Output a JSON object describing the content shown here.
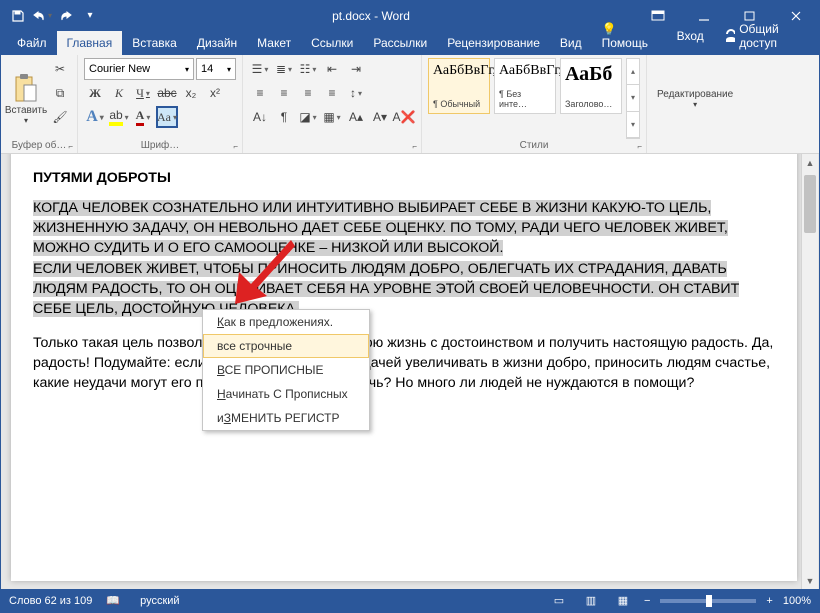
{
  "titlebar": {
    "title": "pt.docx - Word"
  },
  "tabs": {
    "file": "Файл",
    "home": "Главная",
    "insert": "Вставка",
    "design": "Дизайн",
    "layout": "Макет",
    "references": "Ссылки",
    "mailings": "Рассылки",
    "review": "Рецензирование",
    "view": "Вид",
    "tellme": "Помощь",
    "signin": "Вход",
    "share": "Общий доступ"
  },
  "ribbon": {
    "clipboard": {
      "paste": "Вставить",
      "label": "Буфер об…"
    },
    "font": {
      "name": "Courier New",
      "size": "14",
      "label": "Шриф…"
    },
    "paragraph": {
      "label": ""
    },
    "styles": {
      "label": "Стили",
      "items": [
        {
          "sample": "АаБбВвГг,",
          "name": "¶ Обычный"
        },
        {
          "sample": "АаБбВвГг,",
          "name": "¶ Без инте…"
        },
        {
          "sample": "АаБб",
          "name": "Заголово…"
        }
      ]
    },
    "editing": {
      "label": "Редактирование"
    }
  },
  "dropdown": {
    "opt1": "Как в предложениях.",
    "opt2": "все строчные",
    "opt3": "ВСЕ ПРОПИСНЫЕ",
    "opt4": "Начинать С Прописных",
    "opt5": "иЗМЕНИТЬ РЕГИСТР"
  },
  "doc": {
    "heading": "ПУТЯМИ ДОБРОТЫ",
    "p1": "КОГДА ЧЕЛОВЕК СОЗНАТЕЛЬНО ИЛИ ИНТУИТИВНО ВЫБИРАЕТ СЕБЕ В ЖИЗНИ КАКУЮ-ТО ЦЕЛЬ, ЖИЗНЕННУЮ ЗАДАЧУ, ОН НЕВОЛЬНО ДАЕТ СЕБЕ ОЦЕНКУ. ПО ТОМУ, РАДИ ЧЕГО ЧЕЛОВЕК ЖИВЕТ, МОЖНО СУДИТЬ И О ЕГО САМООЦЕНКЕ – НИЗКОЙ ИЛИ ВЫСОКОЙ.",
    "p2": "ЕСЛИ ЧЕЛОВЕК ЖИВЕТ, ЧТОБЫ ПРИНОСИТЬ ЛЮДЯМ ДОБРО, ОБЛЕГЧАТЬ ИХ СТРАДАНИЯ, ДАВАТЬ ЛЮДЯМ РАДОСТЬ, ТО ОН ОЦЕНИВАЕТ СЕБЯ НА УРОВНЕ ЭТОЙ СВОЕЙ ЧЕЛОВЕЧНОСТИ. ОН СТАВИТ СЕБЕ ЦЕЛЬ, ДОСТОЙНУЮ ЧЕЛОВЕКА.",
    "p3": "Только такая цель позволяет человеку прожить свою жизнь с достоинством и получить настоящую радость. Да, радость! Подумайте: если человек ставит себе задачей увеличивать в жизни добро, приносить людям счастье, какие неудачи могут его постигнуть? Не тому помочь? Но много ли людей не нуждаются в помощи?"
  },
  "status": {
    "words": "Слово 62 из 109",
    "lang": "русский",
    "zoom": "100%"
  }
}
